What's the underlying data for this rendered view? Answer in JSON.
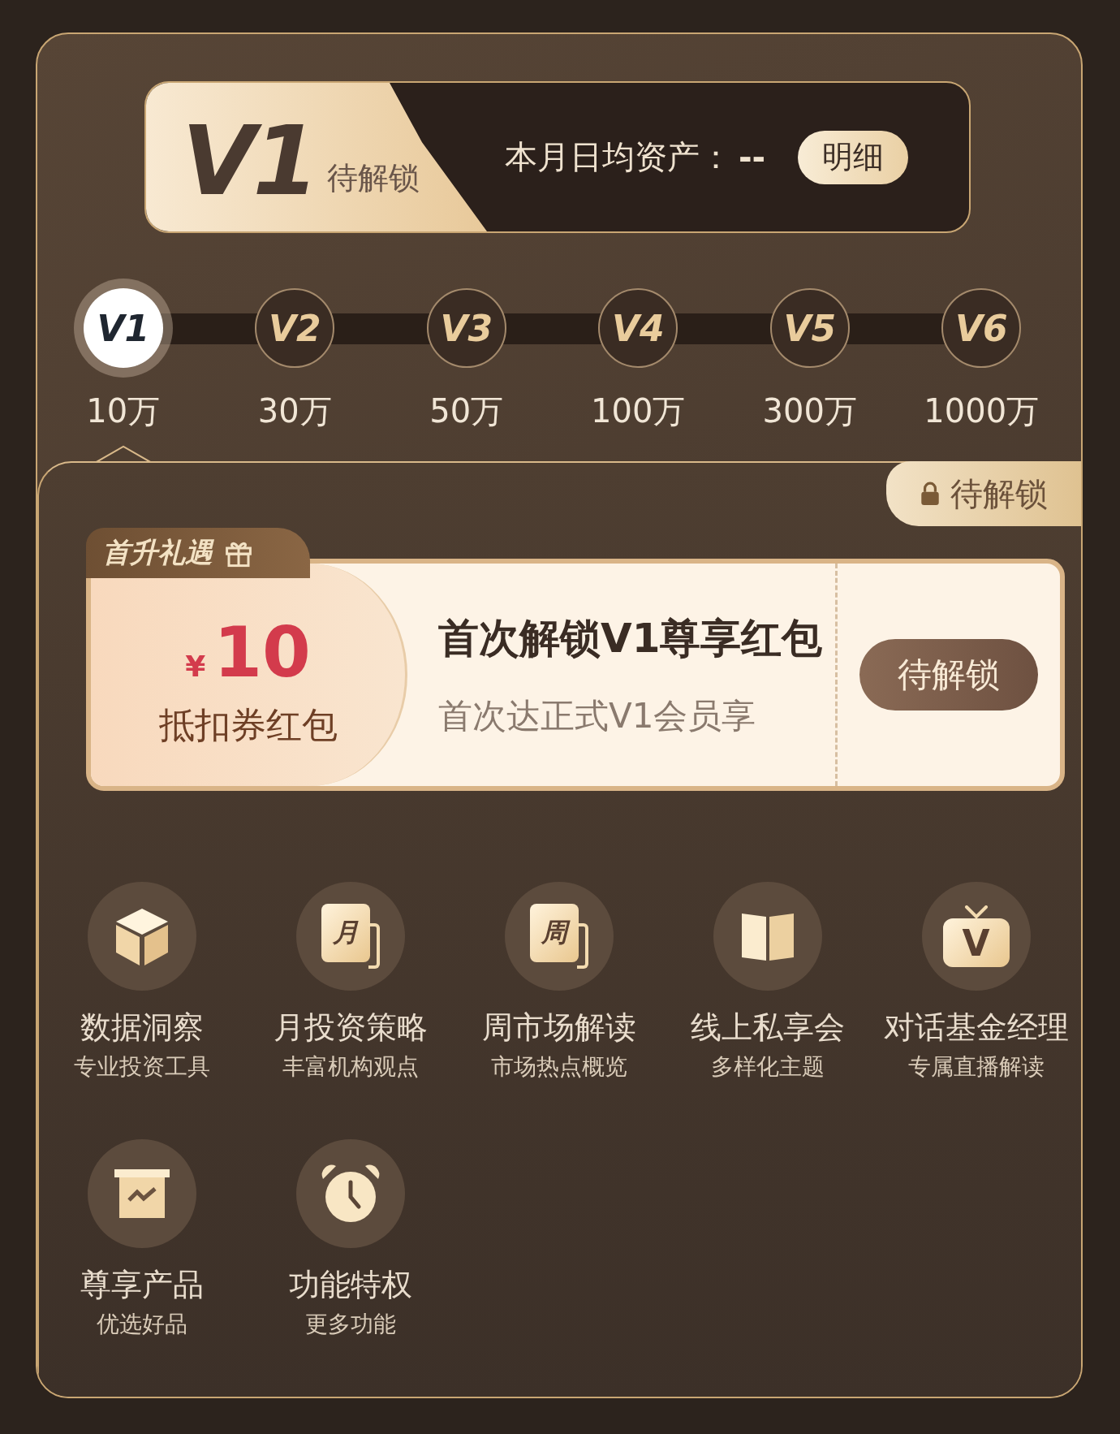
{
  "banner": {
    "level": "V1",
    "status": "待解锁",
    "asset_label": "本月日均资产：",
    "asset_value": "--",
    "detail_button": "明细"
  },
  "levels": [
    {
      "badge": "V1",
      "amount": "10万",
      "selected": true
    },
    {
      "badge": "V2",
      "amount": "30万",
      "selected": false
    },
    {
      "badge": "V3",
      "amount": "50万",
      "selected": false
    },
    {
      "badge": "V4",
      "amount": "100万",
      "selected": false
    },
    {
      "badge": "V5",
      "amount": "300万",
      "selected": false
    },
    {
      "badge": "V6",
      "amount": "1000万",
      "selected": false
    }
  ],
  "panel": {
    "status": "待解锁"
  },
  "coupon": {
    "tag": "首升礼遇",
    "currency": "¥",
    "amount": "10",
    "type": "抵扣券红包",
    "title": "首次解锁V1尊享红包",
    "subtitle": "首次达正式V1会员享",
    "button": "待解锁"
  },
  "features": [
    {
      "kind": "cube",
      "title": "数据洞察",
      "subtitle": "专业投资工具"
    },
    {
      "kind": "calendar",
      "glyph": "月",
      "title": "月投资策略",
      "subtitle": "丰富机构观点"
    },
    {
      "kind": "calendar",
      "glyph": "周",
      "title": "周市场解读",
      "subtitle": "市场热点概览"
    },
    {
      "kind": "book",
      "title": "线上私享会",
      "subtitle": "多样化主题"
    },
    {
      "kind": "tv",
      "glyph": "V",
      "title": "对话基金经理",
      "subtitle": "专属直播解读"
    },
    {
      "kind": "board",
      "title": "尊享产品",
      "subtitle": "优选好品"
    },
    {
      "kind": "clock",
      "title": "功能特权",
      "subtitle": "更多功能"
    }
  ]
}
